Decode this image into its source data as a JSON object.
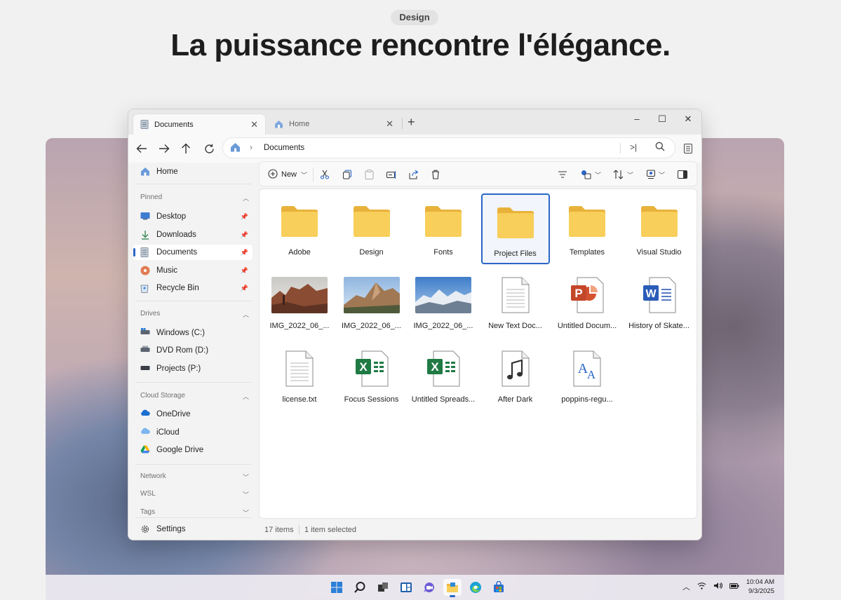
{
  "hero": {
    "pill": "Design",
    "headline": "La puissance rencontre l'élégance."
  },
  "window": {
    "tabs": [
      {
        "label": "Documents",
        "active": true
      },
      {
        "label": "Home",
        "active": false
      }
    ],
    "new_tab": "+",
    "controls": {
      "minimize": "–",
      "maximize": "☐",
      "close": "✕"
    },
    "address": {
      "crumb": "Documents"
    }
  },
  "sidebar": {
    "home": "Home",
    "sections": {
      "pinned": "Pinned",
      "drives": "Drives",
      "cloud": "Cloud Storage",
      "network": "Network",
      "wsl": "WSL",
      "tags": "Tags"
    },
    "pinned": [
      {
        "label": "Desktop"
      },
      {
        "label": "Downloads"
      },
      {
        "label": "Documents"
      },
      {
        "label": "Music"
      },
      {
        "label": "Recycle Bin"
      }
    ],
    "drives": [
      {
        "label": "Windows (C:)"
      },
      {
        "label": "DVD Rom (D:)"
      },
      {
        "label": "Projects (P:)"
      }
    ],
    "cloud": [
      {
        "label": "OneDrive"
      },
      {
        "label": "iCloud"
      },
      {
        "label": "Google Drive"
      }
    ],
    "settings": "Settings"
  },
  "toolbar": {
    "new_label": "New"
  },
  "files": [
    {
      "name": "Adobe",
      "kind": "folder"
    },
    {
      "name": "Design",
      "kind": "folder"
    },
    {
      "name": "Fonts",
      "kind": "folder"
    },
    {
      "name": "Project Files",
      "kind": "folder",
      "selected": true
    },
    {
      "name": "Templates",
      "kind": "folder"
    },
    {
      "name": "Visual Studio",
      "kind": "folder"
    },
    {
      "name": "IMG_2022_06_...",
      "kind": "photo1"
    },
    {
      "name": "IMG_2022_06_...",
      "kind": "photo2"
    },
    {
      "name": "IMG_2022_06_...",
      "kind": "photo3"
    },
    {
      "name": "New Text Doc...",
      "kind": "text"
    },
    {
      "name": "Untitled Docum...",
      "kind": "powerpoint"
    },
    {
      "name": "History of Skate...",
      "kind": "word"
    },
    {
      "name": "license.txt",
      "kind": "text"
    },
    {
      "name": "Focus Sessions",
      "kind": "excel"
    },
    {
      "name": "Untitled Spreads...",
      "kind": "excel"
    },
    {
      "name": "After Dark",
      "kind": "music"
    },
    {
      "name": "poppins-regu...",
      "kind": "font"
    }
  ],
  "status": {
    "items": "17 items",
    "selected": "1 item selected"
  },
  "taskbar": {
    "time": "10:04 AM",
    "date": "9/3/2025",
    "icons": [
      "windows-start-icon",
      "search-icon",
      "task-view-icon",
      "widgets-icon",
      "chat-icon",
      "file-explorer-icon",
      "edge-icon",
      "store-icon"
    ]
  },
  "colors": {
    "accent": "#2a66c8",
    "folder": "#f5c84c",
    "excel": "#1f7a44",
    "word": "#2b5cb8",
    "powerpoint": "#c4472a"
  }
}
